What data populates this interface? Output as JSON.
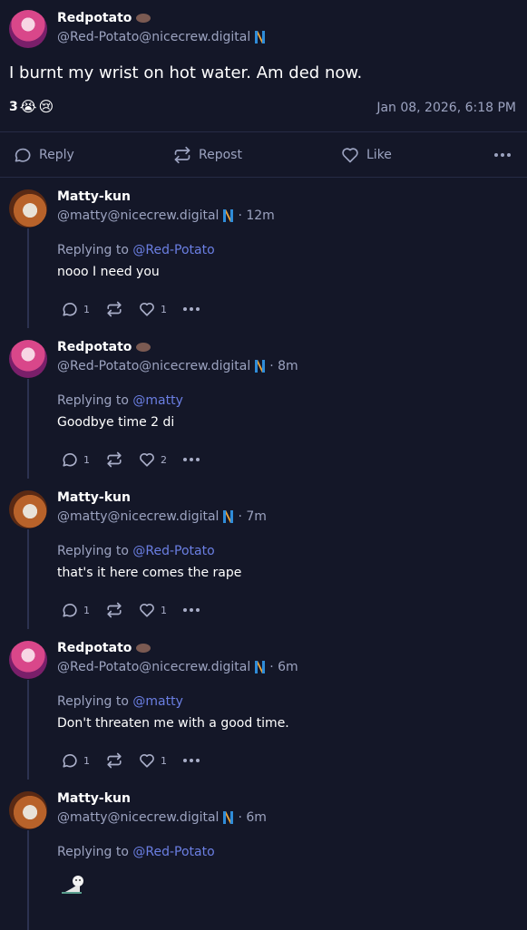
{
  "main_post": {
    "author_name": "Redpotato",
    "handle": "@Red-Potato@nicecrew.digital",
    "text": "I burnt my wrist on hot water. Am ded now.",
    "reaction_count": "3",
    "reaction_emojis": [
      "😭",
      "😢"
    ],
    "timestamp": "Jan 08, 2026, 6:18 PM",
    "actions": {
      "reply": "Reply",
      "repost": "Repost",
      "like": "Like"
    }
  },
  "replying_prefix": "Replying to",
  "replies": [
    {
      "author_name": "Matty-kun",
      "handle": "@matty@nicecrew.digital",
      "time": "· 12m",
      "replying_to": "@Red-Potato",
      "text": "nooo I need you",
      "reply_count": "1",
      "like_count": "1",
      "avatar": "matty"
    },
    {
      "author_name": "Redpotato",
      "handle": "@Red-Potato@nicecrew.digital",
      "time": "· 8m",
      "replying_to": "@matty",
      "text": "Goodbye time 2 di",
      "reply_count": "1",
      "like_count": "2",
      "avatar": "red"
    },
    {
      "author_name": "Matty-kun",
      "handle": "@matty@nicecrew.digital",
      "time": "· 7m",
      "replying_to": "@Red-Potato",
      "text": "that's it here comes the rape",
      "reply_count": "1",
      "like_count": "1",
      "avatar": "matty"
    },
    {
      "author_name": "Redpotato",
      "handle": "@Red-Potato@nicecrew.digital",
      "time": "· 6m",
      "replying_to": "@matty",
      "text": "Don't threaten me with a good time.",
      "reply_count": "1",
      "like_count": "1",
      "avatar": "red"
    },
    {
      "author_name": "Matty-kun",
      "handle": "@matty@nicecrew.digital",
      "time": "· 6m",
      "replying_to": "@Red-Potato",
      "text": "",
      "avatar": "matty"
    }
  ],
  "colors": {
    "background": "#141728",
    "mention": "#6b7fe3",
    "muted": "#9ca3c0"
  }
}
